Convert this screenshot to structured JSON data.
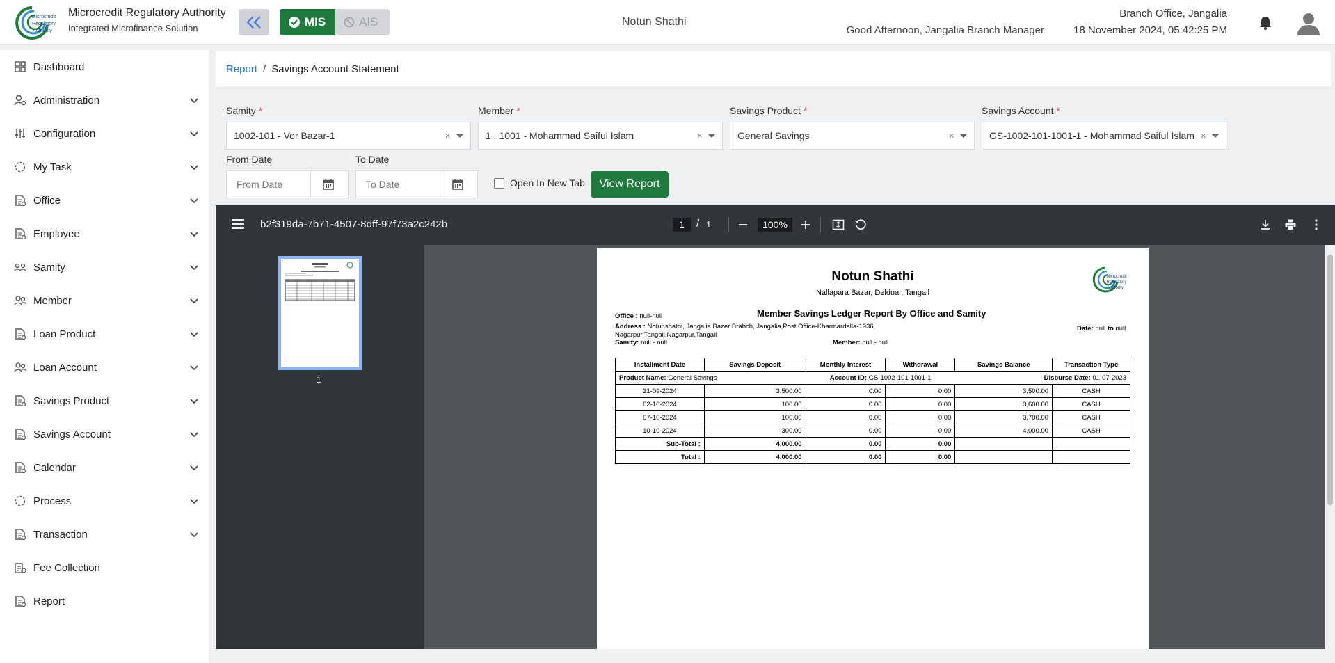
{
  "header": {
    "org_title": "Microcredit Regulatory Authority",
    "org_subtitle": "Integrated Microfinance Solution",
    "logo_text": "Microcredit Regulatory Authority",
    "mode_mis": "MIS",
    "mode_ais": "AIS",
    "center_org": "Notun Shathi",
    "greeting": "Good Afternoon, Jangalia Branch Manager",
    "branch": "Branch Office, Jangalia",
    "datetime": "18 November 2024, 05:42:25 PM"
  },
  "sidebar": {
    "items": [
      {
        "label": "Dashboard",
        "icon": "dashboard-icon",
        "chevron": false
      },
      {
        "label": "Administration",
        "icon": "admin-icon",
        "chevron": true
      },
      {
        "label": "Configuration",
        "icon": "sliders-icon",
        "chevron": true
      },
      {
        "label": "My Task",
        "icon": "task-icon",
        "chevron": true
      },
      {
        "label": "Office",
        "icon": "office-icon",
        "chevron": true
      },
      {
        "label": "Employee",
        "icon": "employee-icon",
        "chevron": true
      },
      {
        "label": "Samity",
        "icon": "samity-icon",
        "chevron": true
      },
      {
        "label": "Member",
        "icon": "member-icon",
        "chevron": true
      },
      {
        "label": "Loan Product",
        "icon": "loan-product-icon",
        "chevron": true
      },
      {
        "label": "Loan Account",
        "icon": "loan-account-icon",
        "chevron": true
      },
      {
        "label": "Savings Product",
        "icon": "savings-product-icon",
        "chevron": true
      },
      {
        "label": "Savings Account",
        "icon": "savings-account-icon",
        "chevron": true
      },
      {
        "label": "Calendar",
        "icon": "calendar-icon",
        "chevron": true
      },
      {
        "label": "Process",
        "icon": "process-icon",
        "chevron": true
      },
      {
        "label": "Transaction",
        "icon": "transaction-icon",
        "chevron": true
      },
      {
        "label": "Fee Collection",
        "icon": "fee-icon",
        "chevron": false
      },
      {
        "label": "Report",
        "icon": "report-icon",
        "chevron": false
      }
    ]
  },
  "breadcrumb": {
    "parent": "Report",
    "separator": "/",
    "current": "Savings Account Statement"
  },
  "filters": {
    "samity_label": "Samity",
    "samity_value": "1002-101 - Vor Bazar-1",
    "member_label": "Member",
    "member_value": "1 . 1001 - Mohammad Saiful Islam",
    "product_label": "Savings Product",
    "product_value": "General Savings",
    "account_label": "Savings Account",
    "account_value": "GS-1002-101-1001-1 - Mohammad Saiful Islam",
    "required_mark": "*",
    "clear_mark": "×",
    "from_label": "From Date",
    "from_placeholder": "From Date",
    "to_label": "To Date",
    "to_placeholder": "To Date",
    "new_tab_label": "Open In New Tab",
    "view_button": "View Report"
  },
  "pdf": {
    "file_name": "b2f319da-7b71-4507-8dff-97f73a2c242b",
    "current_page": "1",
    "page_sep": "/",
    "total_pages": "1",
    "zoom": "100%",
    "thumb_label": "1"
  },
  "report": {
    "org": "Notun Shathi",
    "address": "Nallapara Bazar, Delduar, Tangail",
    "heading": "Member Savings Ledger Report By Office and Samity",
    "office_label": "Office :",
    "office_value": "null-null",
    "address_label": "Address :",
    "address_value": "Notunshathi, Jangalia Bazer Brabch, Jangalia,Post Office-Kharmardalla-1936,",
    "address_value2": "Nagarpur,Tangail,Nagarpur,Tangail",
    "samity_label": "Samity:",
    "samity_value": "null - null",
    "member_label": "Member:",
    "member_value": "null - null",
    "date_label": "Date:",
    "date_from": "null",
    "date_to_word": "to",
    "date_to": "null",
    "columns": [
      "Installment Date",
      "Savings Deposit",
      "Monthly Interest",
      "Withdrawal",
      "Savings Balance",
      "Transaction Type"
    ],
    "product_label": "Product Name:",
    "product_value": "General Savings",
    "account_label": "Account ID:",
    "account_value": "GS-1002-101-1001-1",
    "disburse_label": "Disburse Date:",
    "disburse_value": "01-07-2023",
    "rows": [
      [
        "21-09-2024",
        "3,500.00",
        "0.00",
        "0.00",
        "3,500.00",
        "CASH"
      ],
      [
        "02-10-2024",
        "100.00",
        "0.00",
        "0.00",
        "3,600.00",
        "CASH"
      ],
      [
        "07-10-2024",
        "100.00",
        "0.00",
        "0.00",
        "3,700.00",
        "CASH"
      ],
      [
        "10-10-2024",
        "300.00",
        "0.00",
        "0.00",
        "4,000.00",
        "CASH"
      ]
    ],
    "subtotal": [
      "Sub-Total :",
      "4,000.00",
      "0.00",
      "0.00"
    ],
    "total": [
      "Total :",
      "4,000.00",
      "0.00",
      "0.00"
    ]
  },
  "colors": {
    "primary_green": "#1e7a3d",
    "link_blue": "#1a73e8",
    "viewer_dark": "#323639"
  }
}
